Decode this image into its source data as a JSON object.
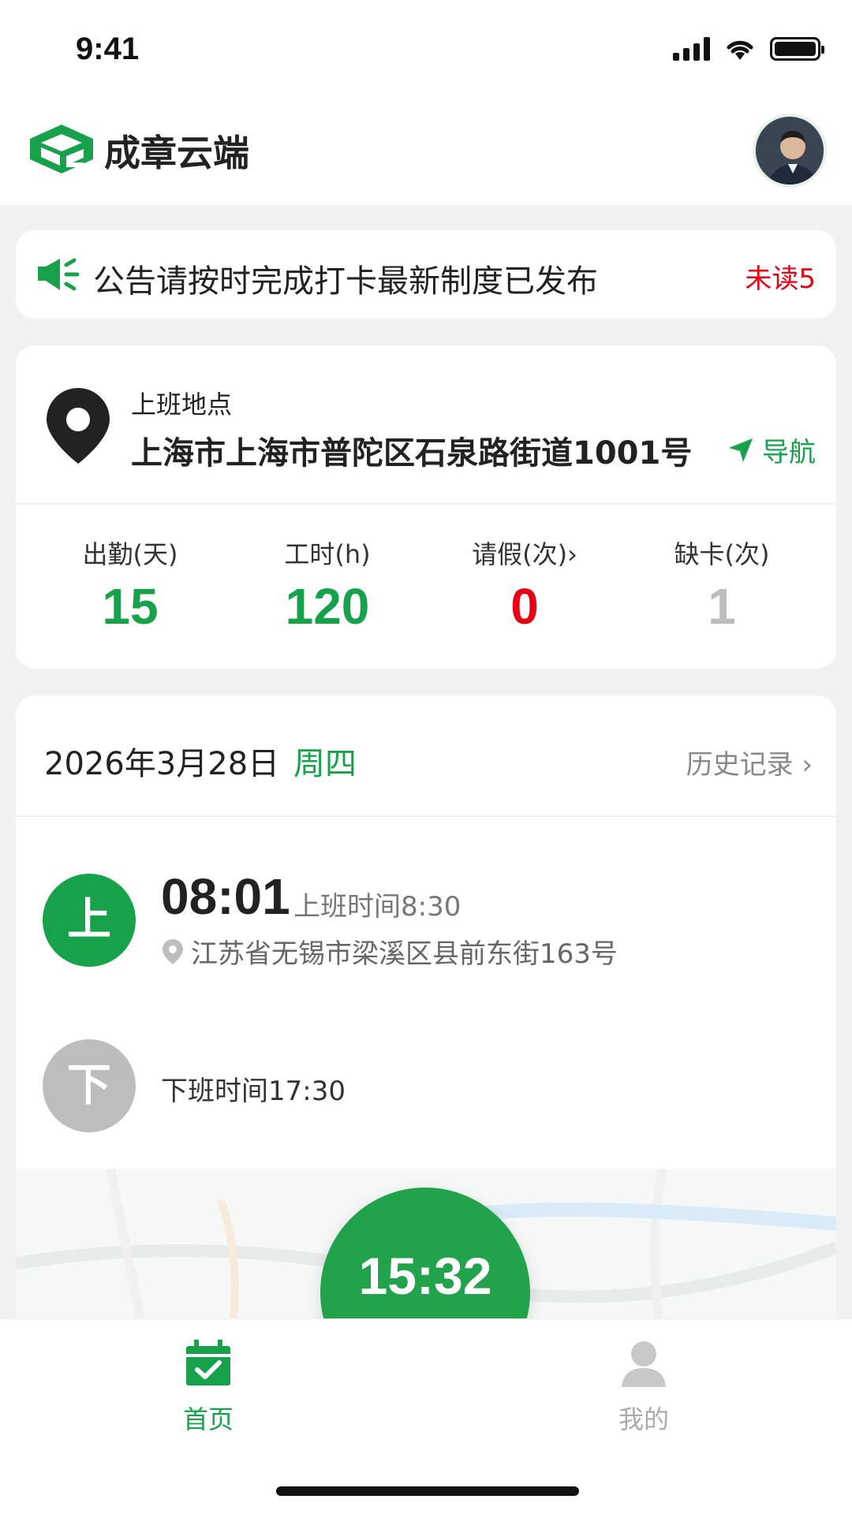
{
  "status_bar": {
    "time": "9:41"
  },
  "header": {
    "brand": "成章云端"
  },
  "notice": {
    "text": "公告请按时完成打卡最新制度已发布",
    "unread": "未读5"
  },
  "location": {
    "label": "上班地点",
    "address": "上海市上海市普陀区石泉路街道1001号",
    "nav_label": "导航"
  },
  "stats": [
    {
      "label": "出勤(天)",
      "value": "15",
      "color": "#17a14a"
    },
    {
      "label": "工时(h)",
      "value": "120",
      "color": "#17a14a"
    },
    {
      "label": "请假(次)›",
      "value": "0",
      "color": "#e60012"
    },
    {
      "label": "缺卡(次)",
      "value": "1",
      "color": "#bdbdbd"
    }
  ],
  "attendance": {
    "date": "2026年3月28日",
    "weekday": "周四",
    "history_label": "历史记录 ›",
    "clock_in": {
      "badge": "上",
      "time": "08:01",
      "schedule": "上班时间8:30",
      "place": "江苏省无锡市梁溪区县前东街163号"
    },
    "clock_out": {
      "badge": "下",
      "schedule": "下班时间17:30"
    },
    "current_time": "15:32"
  },
  "tabs": [
    {
      "label": "首页",
      "icon": "calendar-check-icon",
      "active": true
    },
    {
      "label": "我的",
      "icon": "user-icon",
      "active": false
    }
  ],
  "colors": {
    "brand_green": "#17a14a",
    "alert_red": "#e60012",
    "inactive_gray": "#bdbdbd"
  }
}
